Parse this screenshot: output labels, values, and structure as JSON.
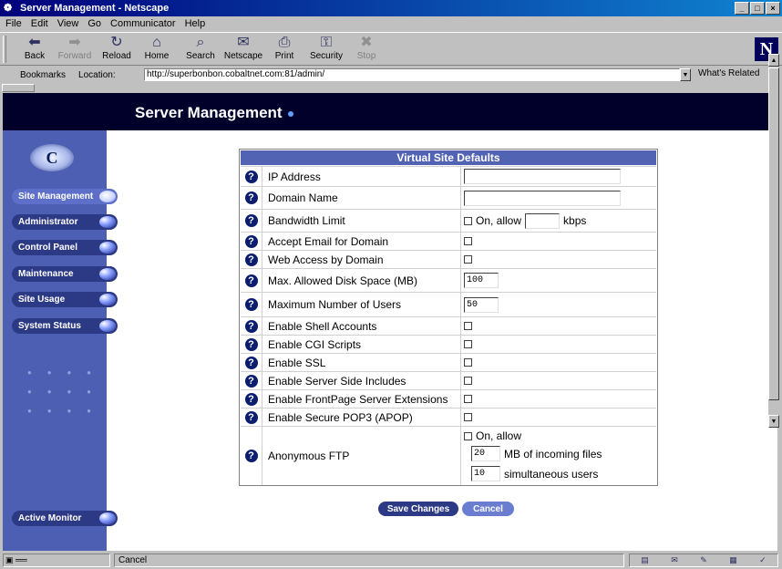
{
  "window": {
    "title": "Server Management - Netscape",
    "controls": [
      "_",
      "□",
      "×"
    ]
  },
  "menu": [
    "File",
    "Edit",
    "View",
    "Go",
    "Communicator",
    "Help"
  ],
  "toolbar": [
    {
      "label": "Back",
      "icon": "back-arrow-icon",
      "glyph": "⬅"
    },
    {
      "label": "Forward",
      "icon": "forward-arrow-icon",
      "glyph": "➡",
      "disabled": true
    },
    {
      "label": "Reload",
      "icon": "reload-icon",
      "glyph": "↻"
    },
    {
      "label": "Home",
      "icon": "home-icon",
      "glyph": "⌂"
    },
    {
      "label": "Search",
      "icon": "search-icon",
      "glyph": "⌕"
    },
    {
      "label": "Netscape",
      "icon": "netscape-icon",
      "glyph": "✉"
    },
    {
      "label": "Print",
      "icon": "print-icon",
      "glyph": "⎙"
    },
    {
      "label": "Security",
      "icon": "security-lock-icon",
      "glyph": "⚿"
    },
    {
      "label": "Stop",
      "icon": "stop-icon",
      "glyph": "✖",
      "disabled": true
    }
  ],
  "location": {
    "bookmarks": "Bookmarks",
    "label": "Location:",
    "url": "http://superbonbon.cobaltnet.com:81/admin/",
    "related": "What's Related"
  },
  "page": {
    "title": "Server Management"
  },
  "sidebar": {
    "items": [
      "Site Management",
      "Administrator",
      "Control Panel",
      "Maintenance",
      "Site Usage",
      "System Status"
    ],
    "active_index": 0,
    "bottom_item": "Active Monitor"
  },
  "form": {
    "header": "Virtual Site Defaults",
    "rows": [
      {
        "label": "IP Address",
        "type": "text",
        "value": ""
      },
      {
        "label": "Domain Name",
        "type": "text",
        "value": ""
      },
      {
        "label": "Bandwidth Limit",
        "type": "checkbox-text",
        "checked": false,
        "prefix": "On, allow",
        "value": "",
        "suffix": "kbps"
      },
      {
        "label": "Accept Email for Domain",
        "type": "checkbox",
        "checked": false
      },
      {
        "label": "Web Access by Domain",
        "type": "checkbox",
        "checked": false
      },
      {
        "label": "Max. Allowed Disk Space (MB)",
        "type": "text",
        "value": "100"
      },
      {
        "label": "Maximum Number of Users",
        "type": "text",
        "value": "50"
      },
      {
        "label": "Enable Shell Accounts",
        "type": "checkbox",
        "checked": false
      },
      {
        "label": "Enable CGI Scripts",
        "type": "checkbox",
        "checked": false
      },
      {
        "label": "Enable SSL",
        "type": "checkbox",
        "checked": false
      },
      {
        "label": "Enable Server Side Includes",
        "type": "checkbox",
        "checked": false
      },
      {
        "label": "Enable FrontPage Server Extensions",
        "type": "checkbox",
        "checked": false
      },
      {
        "label": "Enable Secure POP3 (APOP)",
        "type": "checkbox",
        "checked": false
      }
    ],
    "ftp": {
      "label": "Anonymous FTP",
      "checked": false,
      "checkbox_label": "On, allow",
      "mb_value": "20",
      "mb_label": "MB of incoming files",
      "users_value": "10",
      "users_label": "simultaneous users"
    },
    "save_label": "Save Changes",
    "cancel_label": "Cancel"
  },
  "status": {
    "text": "Cancel"
  },
  "colors": {
    "sidebar": "#4d5fb3",
    "header": "#00002a",
    "table_header": "#5263b4",
    "button": "#2c3a86"
  }
}
